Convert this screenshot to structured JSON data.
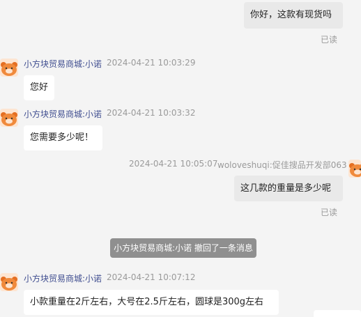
{
  "messages": [
    {
      "text": "你好，这款有现货吗",
      "status": "已读"
    },
    {
      "sender": "小方块贸易商城:小诺",
      "time": "2024-04-21 10:03:29",
      "text": "您好"
    },
    {
      "sender": "小方块贸易商城:小诺",
      "time": "2024-04-21 10:03:32",
      "text": "您需要多少呢！"
    },
    {
      "time": "2024-04-21 10:05:07",
      "sender": "woloveshuqi:促佳搜品开发部063",
      "text": "这几款的重量是多少呢",
      "status": "已读"
    },
    {
      "notice": "小方块贸易商城:小诺 撤回了一条消息"
    },
    {
      "sender": "小方块贸易商城:小诺",
      "time": "2024-04-21 10:07:12",
      "text": "小款重量在2斤左右，大号在2.5斤左右，圆球是300g左右"
    }
  ],
  "avatar_icon": "bear-avatar-icon",
  "colors": {
    "background": "#f4f4f4",
    "outgoing_bubble": "#e9e9e9",
    "incoming_bubble": "#ffffff",
    "sender_name": "#3f4d8f",
    "meta_gray": "#9a9a9a",
    "notice_bg": "#8f8f8f",
    "avatar_orange": "#f08a3c"
  }
}
